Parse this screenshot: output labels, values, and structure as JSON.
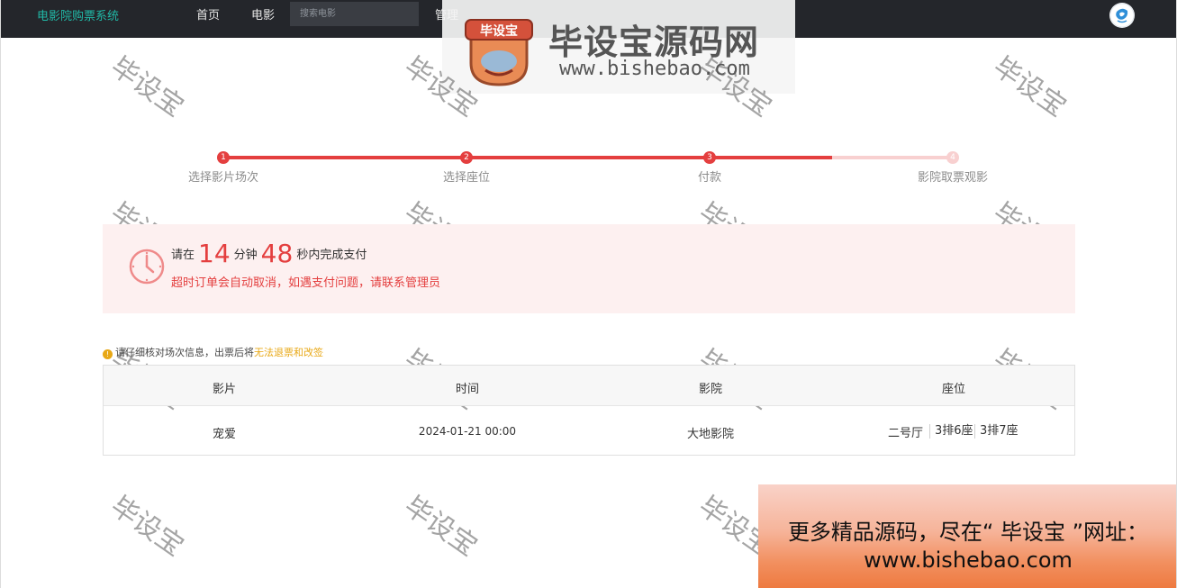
{
  "nav": {
    "brand": "电影院购票系统",
    "items": [
      {
        "label": "首页"
      },
      {
        "label": "电影"
      },
      {
        "label": "管理"
      }
    ],
    "search_placeholder": "搜索电影"
  },
  "watermark": {
    "logo_text": "毕设宝",
    "title": "毕设宝源码网",
    "url": "www.bishebao.com",
    "diagonal_text": "毕设宝"
  },
  "steps": [
    {
      "number": "1",
      "label": "选择影片场次",
      "state": "done"
    },
    {
      "number": "2",
      "label": "选择座位",
      "state": "done"
    },
    {
      "number": "3",
      "label": "付款",
      "state": "active"
    },
    {
      "number": "4",
      "label": "影院取票观影",
      "state": "pending"
    }
  ],
  "countdown": {
    "prefix": "请在",
    "minutes": "14",
    "minutes_unit": "分钟",
    "seconds": "48",
    "suffix": "秒内完成支付",
    "warning": "超时订单会自动取消，如遇支付问题，请联系管理员"
  },
  "notice": {
    "icon": "!",
    "text": "请仔细核对场次信息，出票后将",
    "highlight": "无法退票和改签"
  },
  "table": {
    "headers": [
      "影片",
      "时间",
      "影院",
      "座位"
    ],
    "row": {
      "movie": "宠爱",
      "time": "2024-01-21 00:00",
      "cinema": "大地影院",
      "hall": "二号厅",
      "seats": [
        "3排6座",
        "3排7座"
      ]
    }
  },
  "promo": {
    "line1": "更多精品源码，尽在“ 毕设宝 ”网址：",
    "line2": "www.bishebao.com"
  },
  "colors": {
    "accent": "#e43f3f",
    "nav_bg": "#24262b",
    "brand": "#21b9a7",
    "warning": "#e8a816",
    "step_pending": "#f8d0d0"
  }
}
